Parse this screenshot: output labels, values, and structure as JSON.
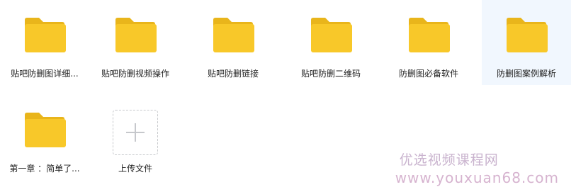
{
  "files": [
    {
      "name": "贴吧防删图详细...",
      "type": "folder-icon",
      "hovered": false
    },
    {
      "name": "贴吧防删视频操作",
      "type": "folder-icon",
      "hovered": false
    },
    {
      "name": "贴吧防删链接",
      "type": "folder-icon",
      "hovered": false
    },
    {
      "name": "贴吧防删二维码",
      "type": "folder-icon",
      "hovered": false
    },
    {
      "name": "防删图必备软件",
      "type": "folder-icon",
      "hovered": false
    },
    {
      "name": "防删图案例解析",
      "type": "folder-icon",
      "hovered": true
    },
    {
      "name": "第一章 ：简单了...",
      "type": "folder-icon",
      "hovered": false
    }
  ],
  "upload": {
    "label": "上传文件",
    "icon": "plus-icon"
  },
  "watermark": {
    "line1": "优选视频课程网",
    "line2": "www.youxuan68.com"
  },
  "colors": {
    "folder_body": "#F8C829",
    "folder_tab": "#E9B51B",
    "hover_bg": "#F1F7FE",
    "watermark": "#C9B3CE"
  }
}
